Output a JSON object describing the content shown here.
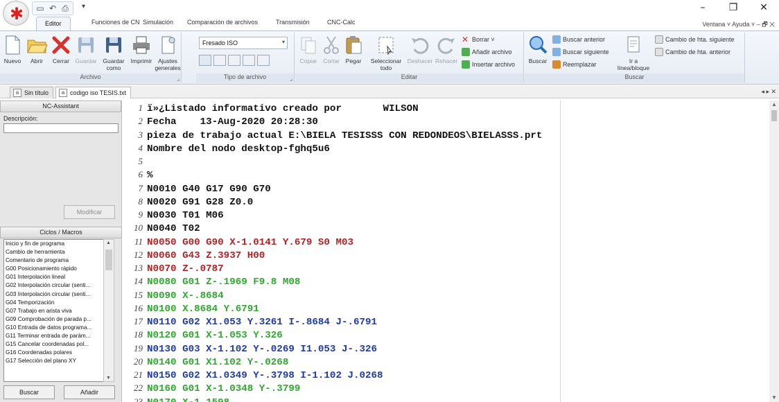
{
  "qat": {
    "icons": [
      "save-icon",
      "undo-icon",
      "print-icon"
    ]
  },
  "window": {
    "controls": [
      "–",
      "❐",
      "✕"
    ]
  },
  "ribbon_tabs": [
    "Editor",
    "Funciones de CN",
    "Simulación",
    "Comparación de archivos",
    "Transmisión",
    "CNC-Calc"
  ],
  "help_area": "Ventana ˅ Ayuda ˅ ‒ 🗗 ✕",
  "groups": {
    "archivo": {
      "label": "Archivo",
      "buttons": [
        "Nuevo",
        "Abrir",
        "Cerrar",
        "Guardar",
        "Guardar como",
        "Imprimir",
        "Ajustes generales"
      ]
    },
    "tipo": {
      "label": "Tipo de archivo",
      "combo_value": "Fresado ISO"
    },
    "editar": {
      "label": "Editar",
      "buttons": [
        "Copiar",
        "Cortar",
        "Pegar",
        "Seleccionar todo",
        "Deshacer",
        "Rehacer"
      ],
      "small": [
        "Borrar ˅",
        "Añadir archivo",
        "Insertar archivo"
      ]
    },
    "buscar": {
      "label": "Buscar",
      "big": "Buscar",
      "small": [
        "Buscar anterior",
        "Buscar siguiente",
        "Reemplazar"
      ],
      "goto": "Ir a línea/bloque",
      "tool": [
        "Cambio de hta. siguiente",
        "Cambio de hta. anterior"
      ]
    }
  },
  "doc_tabs": [
    "Sin título",
    "codigo iso TESIS.txt"
  ],
  "doc_tabs_ctl": "◂ ▸ ✕",
  "left_panel": {
    "title": "NC-Assistant",
    "desc_label": "Descripción:",
    "modify": "Modificar",
    "macros_title": "Ciclos / Macros",
    "macros": [
      "Inicio y fin de programa",
      "Cambio de herramienta",
      "Comentario de programa",
      "G00 Posicionamiento rápido",
      "G01 Interpolación lineal",
      "G02 Interpolación circular (senti...",
      "G03 Interpolación circular (senti...",
      "G04 Temporización",
      "G07 Trabajo en arista viva",
      "G09 Comprobación de parada p...",
      "G10 Entrada de datos programa...",
      "G11 Terminar entrada de parám...",
      "G15 Cancelar coordenadas pol...",
      "G16 Coordenadas polares",
      "G17 Selección del plano XY"
    ],
    "search": "Buscar",
    "add": "Añadir"
  },
  "editor_lines": [
    {
      "n": "1",
      "text": "ï»¿Listado informativo creado por       WILSON",
      "color": "#111111"
    },
    {
      "n": "2",
      "text": "Fecha    13-Aug-2020 20:28:30",
      "color": "#111111"
    },
    {
      "n": "3",
      "text": "pieza de trabajo actual E:\\BIELA TESISSS CON REDONDEOS\\BIELASSS.prt",
      "color": "#111111"
    },
    {
      "n": "4",
      "text": "Nombre del nodo desktop-fghq5u6",
      "color": "#111111"
    },
    {
      "n": "5",
      "text": "",
      "color": "#111111"
    },
    {
      "n": "6",
      "text": "%",
      "color": "#111111"
    },
    {
      "n": "7",
      "text": "N0010 G40 G17 G90 G70",
      "color": "#111111"
    },
    {
      "n": "8",
      "text": "N0020 G91 G28 Z0.0",
      "color": "#111111"
    },
    {
      "n": "9",
      "text": "N0030 T01 M06",
      "color": "#111111"
    },
    {
      "n": "10",
      "text": "N0040 T02",
      "color": "#111111"
    },
    {
      "n": "11",
      "text": "N0050 G00 G90 X-1.0141 Y.679 S0 M03",
      "color": "#b22222"
    },
    {
      "n": "12",
      "text": "N0060 G43 Z.3937 H00",
      "color": "#b22222"
    },
    {
      "n": "13",
      "text": "N0070 Z-.0787",
      "color": "#b22222"
    },
    {
      "n": "14",
      "text": "N0080 G01 Z-.1969 F9.8 M08",
      "color": "#2ea82e"
    },
    {
      "n": "15",
      "text": "N0090 X-.8684",
      "color": "#2ea82e"
    },
    {
      "n": "16",
      "text": "N0100 X.8684 Y.6791",
      "color": "#2ea82e"
    },
    {
      "n": "17",
      "text": "N0110 G02 X1.053 Y.3261 I-.8684 J-.6791",
      "color": "#1f3aa8"
    },
    {
      "n": "18",
      "text": "N0120 G01 X-1.053 Y.326",
      "color": "#2ea82e"
    },
    {
      "n": "19",
      "text": "N0130 G03 X-1.102 Y-.0269 I1.053 J-.326",
      "color": "#1f3aa8"
    },
    {
      "n": "20",
      "text": "N0140 G01 X1.102 Y-.0268",
      "color": "#2ea82e"
    },
    {
      "n": "21",
      "text": "N0150 G02 X1.0349 Y-.3798 I-1.102 J.0268",
      "color": "#1f3aa8"
    },
    {
      "n": "22",
      "text": "N0160 G01 X-1.0348 Y-.3799",
      "color": "#2ea82e"
    },
    {
      "n": "23",
      "text": "N0170 X-1.1598",
      "color": "#2ea82e"
    }
  ]
}
